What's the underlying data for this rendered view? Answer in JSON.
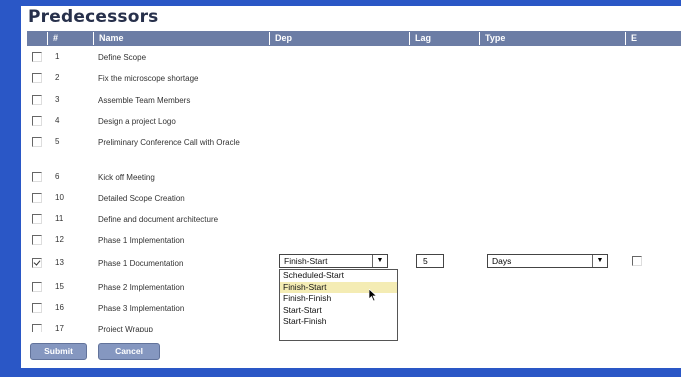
{
  "panel": {
    "title": "Predecessors"
  },
  "header": {
    "columns": [
      "",
      "#",
      "Name",
      "Dep",
      "Lag",
      "Type",
      "E"
    ]
  },
  "rows": [
    {
      "num": "1",
      "name": "Define Scope",
      "checked": false
    },
    {
      "num": "2",
      "name": "Fix the microscope shortage",
      "checked": false
    },
    {
      "num": "3",
      "name": "Assemble Team Members",
      "checked": false
    },
    {
      "num": "4",
      "name": "Design a project Logo",
      "checked": false
    },
    {
      "num": "5",
      "name": "Preliminary Conference Call with Oracle",
      "checked": false
    },
    {
      "num": "6",
      "name": "Kick off Meeting",
      "checked": false
    },
    {
      "num": "10",
      "name": "Detailed Scope Creation",
      "checked": false
    },
    {
      "num": "11",
      "name": "Define and document architecture",
      "checked": false
    },
    {
      "num": "12",
      "name": "Phase 1 Implementation",
      "checked": false
    },
    {
      "num": "13",
      "name": "Phase 1 Documentation",
      "checked": true
    },
    {
      "num": "15",
      "name": "Phase 2 Implementation",
      "checked": false
    },
    {
      "num": "16",
      "name": "Phase 3 Implementation",
      "checked": false
    },
    {
      "num": "17",
      "name": "Project Wrapup",
      "checked": false
    }
  ],
  "selected_row": {
    "dep_value": "Finish-Start",
    "dep_options": [
      "Scheduled-Start",
      "Finish-Start",
      "Finish-Finish",
      "Start-Start",
      "Start-Finish"
    ],
    "dep_highlighted": "Finish-Start",
    "lag_value": "5",
    "type_value": "Days",
    "e_checked": false
  },
  "buttons": {
    "submit": "Submit",
    "cancel": "Cancel"
  },
  "icons": {
    "dropdown": "chevron-down-icon",
    "cursor": "mouse-pointer-icon"
  },
  "colors": {
    "background": "#2a57c6",
    "header": "#6c7da5",
    "highlight": "#f4ecb4",
    "button": "#8597c0"
  }
}
